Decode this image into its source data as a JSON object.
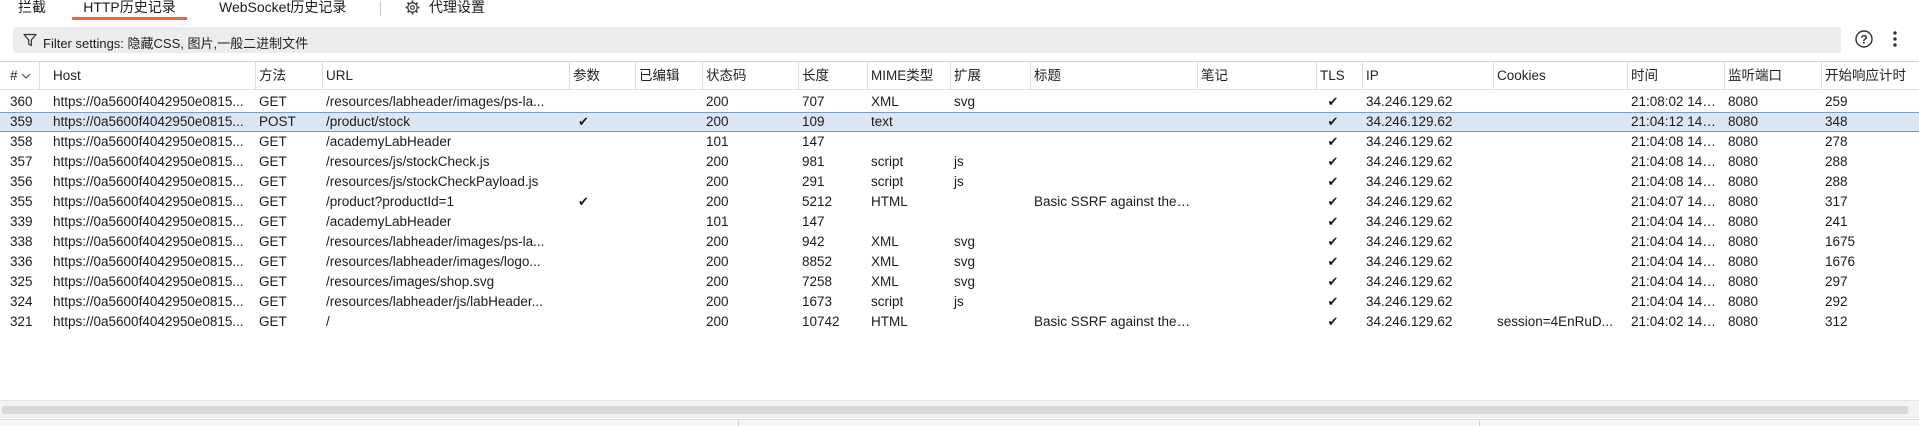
{
  "tabs": [
    {
      "label": "拦截"
    },
    {
      "label": "HTTP历史记录"
    },
    {
      "label": "WebSocket历史记录"
    },
    {
      "label": "代理设置"
    }
  ],
  "filter": {
    "text": "Filter settings: 隐藏CSS, 图片,一般二进制文件"
  },
  "accent_color": "#e8692f",
  "selection_color": "#dbe6f4",
  "columns": [
    {
      "label": "#"
    },
    {
      "label": "Host"
    },
    {
      "label": "方法"
    },
    {
      "label": "URL"
    },
    {
      "label": "参数"
    },
    {
      "label": "已编辑"
    },
    {
      "label": "状态码"
    },
    {
      "label": "长度"
    },
    {
      "label": "MIME类型"
    },
    {
      "label": "扩展"
    },
    {
      "label": "标题"
    },
    {
      "label": "笔记"
    },
    {
      "label": "TLS"
    },
    {
      "label": "IP"
    },
    {
      "label": "Cookies"
    },
    {
      "label": "时间"
    },
    {
      "label": "监听端口"
    },
    {
      "label": "开始响应计时"
    }
  ],
  "sort_indicator": "descending",
  "rows": [
    {
      "num": "360",
      "host": "https://0a5600f4042950e0815...",
      "method": "GET",
      "url": "/resources/labheader/images/ps-la...",
      "params": "",
      "edited": "",
      "status": "200",
      "length": "707",
      "mime": "XML",
      "ext": "svg",
      "title": "",
      "notes": "",
      "tls": "✔",
      "ip": "34.246.129.62",
      "cookies": "",
      "time": "21:08:02 14 J...",
      "port": "8080",
      "resp": "259",
      "selected": false
    },
    {
      "num": "359",
      "host": "https://0a5600f4042950e0815...",
      "method": "POST",
      "url": "/product/stock",
      "params": "✔",
      "edited": "",
      "status": "200",
      "length": "109",
      "mime": "text",
      "ext": "",
      "title": "",
      "notes": "",
      "tls": "✔",
      "ip": "34.246.129.62",
      "cookies": "",
      "time": "21:04:12 14 J...",
      "port": "8080",
      "resp": "348",
      "selected": true
    },
    {
      "num": "358",
      "host": "https://0a5600f4042950e0815...",
      "method": "GET",
      "url": "/academyLabHeader",
      "params": "",
      "edited": "",
      "status": "101",
      "length": "147",
      "mime": "",
      "ext": "",
      "title": "",
      "notes": "",
      "tls": "✔",
      "ip": "34.246.129.62",
      "cookies": "",
      "time": "21:04:08 14 J...",
      "port": "8080",
      "resp": "278",
      "selected": false
    },
    {
      "num": "357",
      "host": "https://0a5600f4042950e0815...",
      "method": "GET",
      "url": "/resources/js/stockCheck.js",
      "params": "",
      "edited": "",
      "status": "200",
      "length": "981",
      "mime": "script",
      "ext": "js",
      "title": "",
      "notes": "",
      "tls": "✔",
      "ip": "34.246.129.62",
      "cookies": "",
      "time": "21:04:08 14 J...",
      "port": "8080",
      "resp": "288",
      "selected": false
    },
    {
      "num": "356",
      "host": "https://0a5600f4042950e0815...",
      "method": "GET",
      "url": "/resources/js/stockCheckPayload.js",
      "params": "",
      "edited": "",
      "status": "200",
      "length": "291",
      "mime": "script",
      "ext": "js",
      "title": "",
      "notes": "",
      "tls": "✔",
      "ip": "34.246.129.62",
      "cookies": "",
      "time": "21:04:08 14 J...",
      "port": "8080",
      "resp": "288",
      "selected": false
    },
    {
      "num": "355",
      "host": "https://0a5600f4042950e0815...",
      "method": "GET",
      "url": "/product?productId=1",
      "params": "✔",
      "edited": "",
      "status": "200",
      "length": "5212",
      "mime": "HTML",
      "ext": "",
      "title": "Basic SSRF against the ...",
      "notes": "",
      "tls": "✔",
      "ip": "34.246.129.62",
      "cookies": "",
      "time": "21:04:07 14 J...",
      "port": "8080",
      "resp": "317",
      "selected": false
    },
    {
      "num": "339",
      "host": "https://0a5600f4042950e0815...",
      "method": "GET",
      "url": "/academyLabHeader",
      "params": "",
      "edited": "",
      "status": "101",
      "length": "147",
      "mime": "",
      "ext": "",
      "title": "",
      "notes": "",
      "tls": "✔",
      "ip": "34.246.129.62",
      "cookies": "",
      "time": "21:04:04 14 J...",
      "port": "8080",
      "resp": "241",
      "selected": false
    },
    {
      "num": "338",
      "host": "https://0a5600f4042950e0815...",
      "method": "GET",
      "url": "/resources/labheader/images/ps-la...",
      "params": "",
      "edited": "",
      "status": "200",
      "length": "942",
      "mime": "XML",
      "ext": "svg",
      "title": "",
      "notes": "",
      "tls": "✔",
      "ip": "34.246.129.62",
      "cookies": "",
      "time": "21:04:04 14 J...",
      "port": "8080",
      "resp": "1675",
      "selected": false
    },
    {
      "num": "336",
      "host": "https://0a5600f4042950e0815...",
      "method": "GET",
      "url": "/resources/labheader/images/logo...",
      "params": "",
      "edited": "",
      "status": "200",
      "length": "8852",
      "mime": "XML",
      "ext": "svg",
      "title": "",
      "notes": "",
      "tls": "✔",
      "ip": "34.246.129.62",
      "cookies": "",
      "time": "21:04:04 14 J...",
      "port": "8080",
      "resp": "1676",
      "selected": false
    },
    {
      "num": "325",
      "host": "https://0a5600f4042950e0815...",
      "method": "GET",
      "url": "/resources/images/shop.svg",
      "params": "",
      "edited": "",
      "status": "200",
      "length": "7258",
      "mime": "XML",
      "ext": "svg",
      "title": "",
      "notes": "",
      "tls": "✔",
      "ip": "34.246.129.62",
      "cookies": "",
      "time": "21:04:04 14 J...",
      "port": "8080",
      "resp": "297",
      "selected": false
    },
    {
      "num": "324",
      "host": "https://0a5600f4042950e0815...",
      "method": "GET",
      "url": "/resources/labheader/js/labHeader...",
      "params": "",
      "edited": "",
      "status": "200",
      "length": "1673",
      "mime": "script",
      "ext": "js",
      "title": "",
      "notes": "",
      "tls": "✔",
      "ip": "34.246.129.62",
      "cookies": "",
      "time": "21:04:04 14 J...",
      "port": "8080",
      "resp": "292",
      "selected": false
    },
    {
      "num": "321",
      "host": "https://0a5600f4042950e0815...",
      "method": "GET",
      "url": "/",
      "params": "",
      "edited": "",
      "status": "200",
      "length": "10742",
      "mime": "HTML",
      "ext": "",
      "title": "Basic SSRF against the ...",
      "notes": "",
      "tls": "✔",
      "ip": "34.246.129.62",
      "cookies": "session=4EnRuD...",
      "time": "21:04:02 14 J...",
      "port": "8080",
      "resp": "312",
      "selected": false
    }
  ]
}
